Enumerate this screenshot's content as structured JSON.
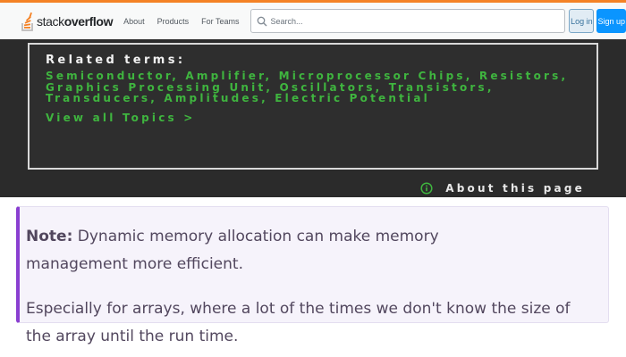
{
  "header": {
    "logo_light": "stack",
    "logo_bold": "overflow",
    "nav": [
      "About",
      "Products",
      "For Teams"
    ],
    "search_placeholder": "Search...",
    "login_label": "Log in",
    "signup_label": "Sign up",
    "accent_color": "#f48225"
  },
  "related": {
    "title": "Related terms:",
    "terms": "Semiconductor, Amplifier, Microprocessor Chips, Resistors, Graphics Processing Unit, Oscillators, Transistors, Transducers, Amplitudes, Electric Potential",
    "view_all": "View all Topics  >",
    "about": "About this page",
    "term_color": "#3fb53f"
  },
  "note": {
    "label": "Note:",
    "text": " Dynamic memory allocation can make memory management more efficient.",
    "paragraph2": "Especially for arrays, where a lot of the times we don't know the size of the array until the run time.",
    "accent_color": "#8a3fd1"
  },
  "icons": {
    "logo": "stack-overflow-logo-icon",
    "search": "search-icon",
    "info": "info-circle-icon"
  }
}
